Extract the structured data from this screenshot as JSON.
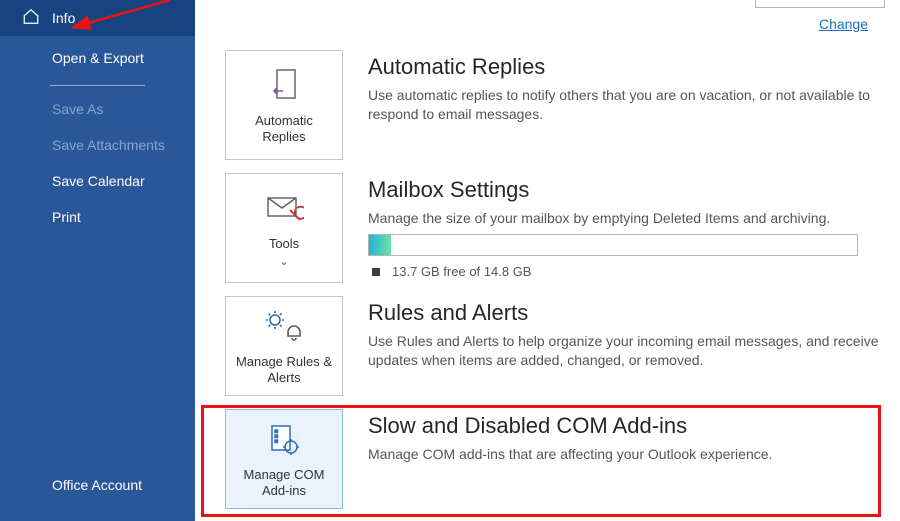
{
  "sidebar": {
    "info": "Info",
    "open_export": "Open & Export",
    "save_as": "Save As",
    "save_attachments": "Save Attachments",
    "save_calendar": "Save Calendar",
    "print": "Print",
    "office_account": "Office Account"
  },
  "change_link": "Change",
  "sections": {
    "auto_replies": {
      "tile": "Automatic Replies",
      "title": "Automatic Replies",
      "desc": "Use automatic replies to notify others that you are on vacation, or not available to respond to email messages."
    },
    "mailbox": {
      "tile": "Tools",
      "title": "Mailbox Settings",
      "desc": "Manage the size of your mailbox by emptying Deleted Items and archiving.",
      "storage": "13.7 GB free of 14.8 GB"
    },
    "rules": {
      "tile": "Manage Rules & Alerts",
      "title": "Rules and Alerts",
      "desc": "Use Rules and Alerts to help organize your incoming email messages, and receive updates when items are added, changed, or removed."
    },
    "addins": {
      "tile": "Manage COM Add-ins",
      "title": "Slow and Disabled COM Add-ins",
      "desc": "Manage COM add-ins that are affecting your Outlook experience."
    }
  }
}
